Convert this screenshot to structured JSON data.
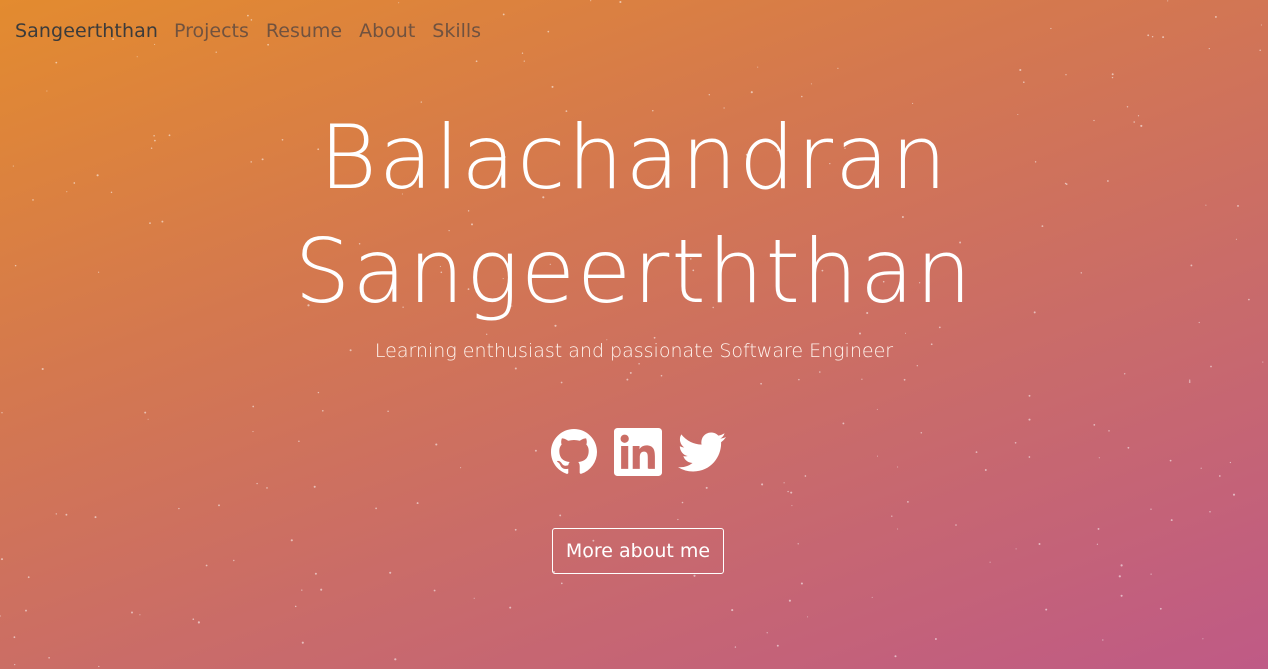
{
  "navbar": {
    "brand": "Sangeerththan",
    "links": [
      "Projects",
      "Resume",
      "About",
      "Skills"
    ]
  },
  "hero": {
    "name_line1": "Balachandran",
    "name_line2": "Sangeerththan",
    "subtitle": "Learning enthusiast and passionate Software Engineer",
    "social_icons": [
      "github-icon",
      "linkedin-icon",
      "twitter-icon"
    ],
    "cta_label": "More about me"
  },
  "colors": {
    "gradient_start": "#e38b2f",
    "gradient_end": "#bf5a86",
    "text": "#ffffff",
    "brand_text": "#3b3b3b"
  }
}
